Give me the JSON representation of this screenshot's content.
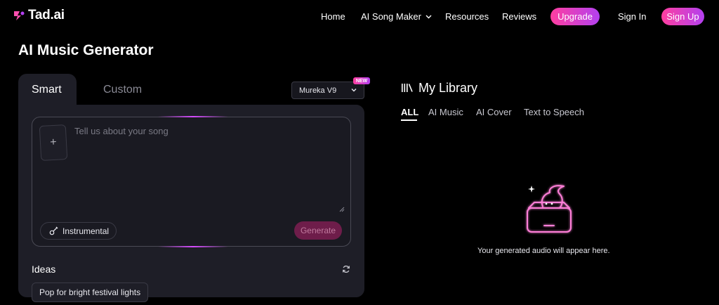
{
  "nav": {
    "logo": "Tad.ai",
    "links": [
      "Home",
      "AI Song Maker",
      "Resources",
      "Reviews"
    ],
    "upgrade": "Upgrade",
    "sign_in": "Sign In",
    "sign_up": "Sign Up"
  },
  "page": {
    "title": "AI Music Generator"
  },
  "generator": {
    "tabs": [
      "Smart",
      "Custom"
    ],
    "active_tab": "Smart",
    "model": "Mureka V9",
    "new_badge": "NEW",
    "upload_symbol": "+",
    "prompt_placeholder": "Tell us about your song",
    "instrumental_label": "Instrumental",
    "generate_label": "Generate",
    "ideas_label": "Ideas",
    "ideas": [
      "Pop for bright festival lights"
    ]
  },
  "library": {
    "title": "My Library",
    "tabs": [
      "ALL",
      "AI Music",
      "AI Cover",
      "Text to Speech"
    ],
    "active_tab": "ALL",
    "empty_message": "Your generated audio will appear here."
  },
  "colors": {
    "accent_start": "#ff3fa0",
    "accent_end": "#b340f0",
    "panel": "#1e1e27",
    "background": "#000000"
  },
  "icons": [
    "logo-icon",
    "chevron-down-icon",
    "plus-icon",
    "guitar-icon",
    "refresh-icon",
    "library-icon",
    "empty-box-icon",
    "resize-handle-icon"
  ]
}
